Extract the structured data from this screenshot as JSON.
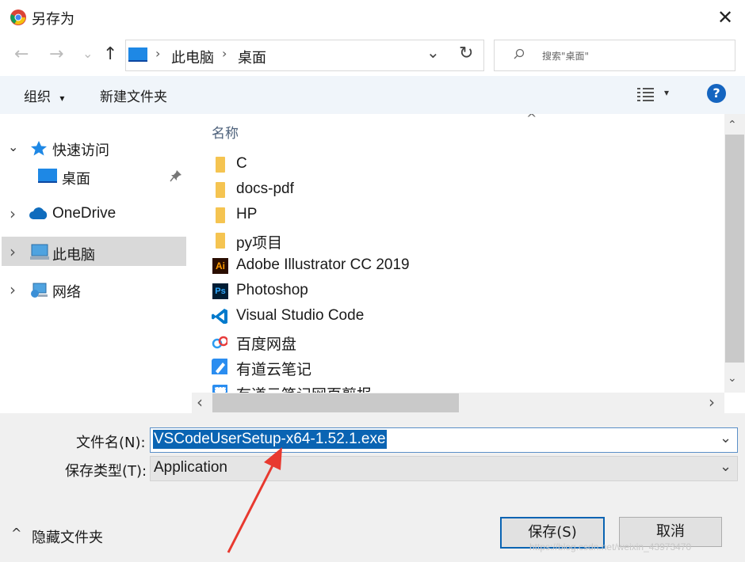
{
  "window": {
    "title": "另存为",
    "close_symbol": "✕"
  },
  "nav": {
    "back_symbol": "←",
    "forward_symbol": "→",
    "recent_symbol": "⌄",
    "up_symbol": "↑",
    "breadcrumb": [
      "此电脑",
      "桌面"
    ],
    "separator": "›",
    "dropdown_symbol": "⌄",
    "refresh_symbol": "↻",
    "search_placeholder": "搜索\"桌面\""
  },
  "toolbar": {
    "organize_label": "组织",
    "organize_caret": "▾",
    "new_folder_label": "新建文件夹",
    "view_caret": "▾",
    "help_symbol": "?"
  },
  "sidebar": {
    "items": [
      {
        "label": "快速访问",
        "expand": "⌄",
        "icon": "star-icon"
      },
      {
        "label": "桌面",
        "icon": "desktop-icon"
      },
      {
        "label": "OneDrive",
        "expand": "›",
        "icon": "cloud-icon"
      },
      {
        "label": "此电脑",
        "expand": "›",
        "icon": "computer-icon",
        "selected": true
      },
      {
        "label": "网络",
        "expand": "›",
        "icon": "network-icon"
      }
    ]
  },
  "filelist": {
    "column_header": "名称",
    "sort_symbol": "^",
    "rows": [
      {
        "name": "C",
        "icon": "folder-icon"
      },
      {
        "name": "docs-pdf",
        "icon": "folder-icon"
      },
      {
        "name": "HP",
        "icon": "folder-icon"
      },
      {
        "name": "py项目",
        "icon": "folder-icon"
      },
      {
        "name": "Adobe Illustrator CC 2019",
        "icon": "illustrator-icon"
      },
      {
        "name": "Photoshop",
        "icon": "photoshop-icon"
      },
      {
        "name": "Visual Studio Code",
        "icon": "vscode-icon"
      },
      {
        "name": "百度网盘",
        "icon": "baidu-netdisk-icon"
      },
      {
        "name": "有道云笔记",
        "icon": "youdao-note-icon"
      },
      {
        "name": "有道云笔记网页剪报",
        "icon": "youdao-clipper-icon"
      }
    ],
    "scroll_up": "⌃",
    "scroll_down": "⌄",
    "scroll_left": "‹",
    "scroll_right": "›"
  },
  "form": {
    "filename_label": "文件名(N):",
    "filename_value": "VSCodeUserSetup-x64-1.52.1.exe",
    "filetype_label": "保存类型(T):",
    "filetype_value": "Application",
    "dropdown_symbol": "⌄"
  },
  "footer": {
    "hide_folders_label": "隐藏文件夹",
    "hide_folders_caret": "^",
    "save_label": "保存(S)",
    "cancel_label": "取消",
    "watermark": "https://blog.csdn.net/weixin_43973470"
  },
  "colors": {
    "selection": "#0a64b3",
    "annotation_arrow": "#e8392f",
    "folder": "#f5c451",
    "toolbar_bg": "#f0f5fa"
  }
}
